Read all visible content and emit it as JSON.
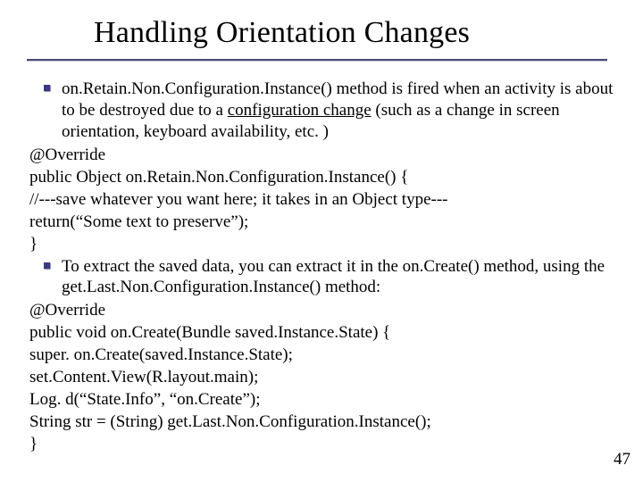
{
  "title": "Handling Orientation Changes",
  "bullet1_part1": "on.Retain.Non.Configuration.Instance() method is fired when an activity is about to be destroyed due to a ",
  "bullet1_underlined": "configuration change",
  "bullet1_part2": " (such as a change in screen orientation, keyboard availability, etc. )",
  "code1_line1": "@Override",
  "code1_line2": "public Object on.Retain.Non.Configuration.Instance() {",
  "code1_line3": "//---save whatever you want here; it takes in an Object type---",
  "code1_line4": "return(“Some text to preserve”); ",
  "code1_line5": "}",
  "bullet2": "To extract the saved data, you can extract it in the on.Create() method, using the get.Last.Non.Configuration.Instance() method:",
  "code2_line1": "@Override",
  "code2_line2": "public void on.Create(Bundle saved.Instance.State) {",
  "code2_line3": "super. on.Create(saved.Instance.State);",
  "code2_line4": "set.Content.View(R.layout.main);",
  "code2_line5": "Log. d(“State.Info”, “on.Create”);",
  "code2_line6": "String str = (String) get.Last.Non.Configuration.Instance(); ",
  "code2_line7": "}",
  "page_number": "47"
}
